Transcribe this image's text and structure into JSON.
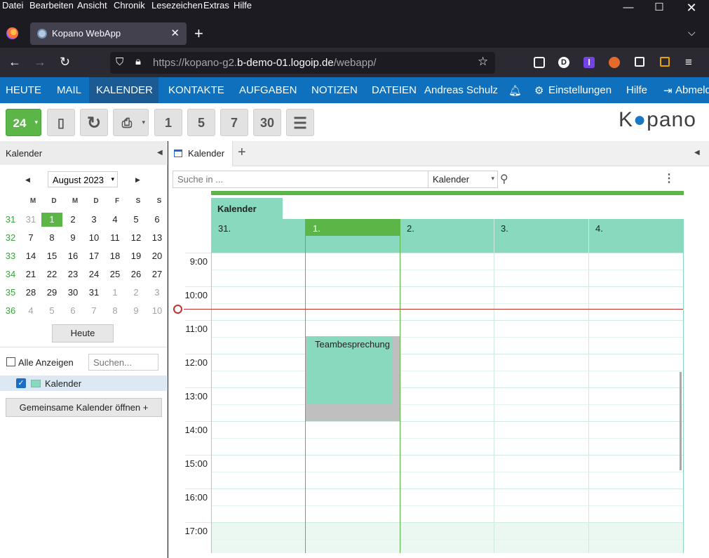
{
  "browser": {
    "menu": [
      "Datei",
      "Bearbeiten",
      "Ansicht",
      "Chronik",
      "Lesezeichen",
      "Extras",
      "Hilfe"
    ],
    "tab_title": "Kopano WebApp",
    "url_dim_prefix": "https://kopano-g2.",
    "url_host": "b-demo-01.logoip.de",
    "url_path": "/webapp/",
    "account_badge": "D",
    "ext_badge": "l"
  },
  "app": {
    "nav": [
      "HEUTE",
      "MAIL",
      "KALENDER",
      "KONTAKTE",
      "AUFGABEN",
      "NOTIZEN",
      "DATEIEN"
    ],
    "user": "Andreas Schulz",
    "settings": "Einstellungen",
    "help": "Hilfe",
    "logout": "Abmelden",
    "logo_left": "K",
    "logo_right": "pano",
    "toolbar": {
      "today_num": "24",
      "day1": "1",
      "day5": "5",
      "day7": "7",
      "day30": "30"
    }
  },
  "sidebar": {
    "title": "Kalender",
    "month": "August 2023",
    "weekday_headers": [
      "M",
      "D",
      "M",
      "D",
      "F",
      "S",
      "S"
    ],
    "weeks": [
      {
        "wk": "31",
        "days": [
          "31",
          "1",
          "2",
          "3",
          "4",
          "5",
          "6"
        ]
      },
      {
        "wk": "32",
        "days": [
          "7",
          "8",
          "9",
          "10",
          "11",
          "12",
          "13"
        ]
      },
      {
        "wk": "33",
        "days": [
          "14",
          "15",
          "16",
          "17",
          "18",
          "19",
          "20"
        ]
      },
      {
        "wk": "34",
        "days": [
          "21",
          "22",
          "23",
          "24",
          "25",
          "26",
          "27"
        ]
      },
      {
        "wk": "35",
        "days": [
          "28",
          "29",
          "30",
          "31",
          "1",
          "2",
          "3"
        ]
      },
      {
        "wk": "36",
        "days": [
          "4",
          "5",
          "6",
          "7",
          "8",
          "9",
          "10"
        ]
      }
    ],
    "today_button": "Heute",
    "show_all": "Alle Anzeigen",
    "search_placeholder": "Suchen...",
    "calendar_item": "Kalender",
    "shared_button": "Gemeinsame Kalender öffnen +"
  },
  "main": {
    "tab_label": "Kalender",
    "search_placeholder": "Suche in ...",
    "search_scope": "Kalender",
    "calendar_name": "Kalender",
    "days": [
      "31.",
      "1.",
      "2.",
      "3.",
      "4."
    ],
    "times": [
      "9:00",
      "10:00",
      "11:00",
      "12:00",
      "13:00",
      "14:00",
      "15:00",
      "16:00",
      "17:00"
    ],
    "event": "Teambesprechung"
  },
  "colors": {
    "accent_blue": "#0f70bd",
    "green": "#5bb547",
    "calendar_mint": "#88d9be",
    "now_line": "#c53030"
  }
}
